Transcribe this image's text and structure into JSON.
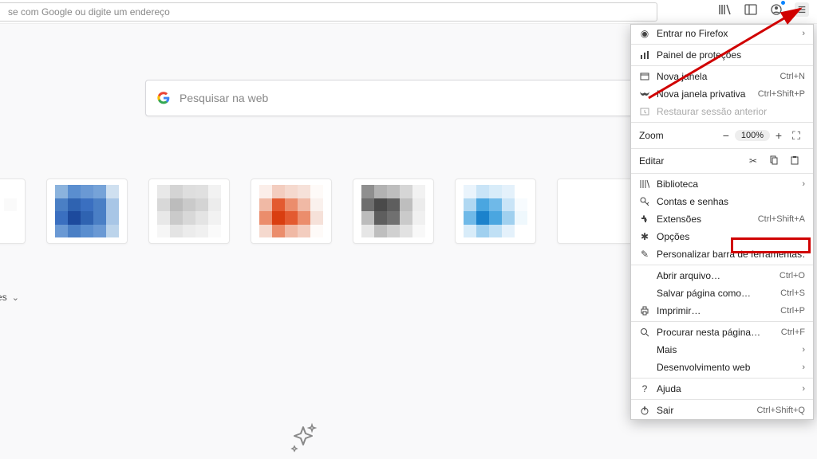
{
  "toolbar": {
    "url_placeholder": "se com Google ou digite um endereço"
  },
  "search": {
    "placeholder": "Pesquisar na web"
  },
  "section": {
    "highlights_label": "estaques"
  },
  "menu": {
    "signin": "Entrar no Firefox",
    "protections": "Painel de proteções",
    "new_window": {
      "label": "Nova janela",
      "shortcut": "Ctrl+N"
    },
    "new_private": {
      "label": "Nova janela privativa",
      "shortcut": "Ctrl+Shift+P"
    },
    "restore": "Restaurar sessão anterior",
    "zoom": {
      "label": "Zoom",
      "value": "100%"
    },
    "edit": "Editar",
    "library": "Biblioteca",
    "logins": "Contas e senhas",
    "addons": {
      "label": "Extensões",
      "shortcut": "Ctrl+Shift+A"
    },
    "options": "Opções",
    "customize": "Personalizar barra de ferramentas…",
    "open_file": {
      "label": "Abrir arquivo…",
      "shortcut": "Ctrl+O"
    },
    "save_as": {
      "label": "Salvar página como…",
      "shortcut": "Ctrl+S"
    },
    "print": {
      "label": "Imprimir…",
      "shortcut": "Ctrl+P"
    },
    "find": {
      "label": "Procurar nesta página…",
      "shortcut": "Ctrl+F"
    },
    "more": "Mais",
    "webdev": "Desenvolvimento web",
    "help": "Ajuda",
    "quit": {
      "label": "Sair",
      "shortcut": "Ctrl+Shift+Q"
    }
  }
}
